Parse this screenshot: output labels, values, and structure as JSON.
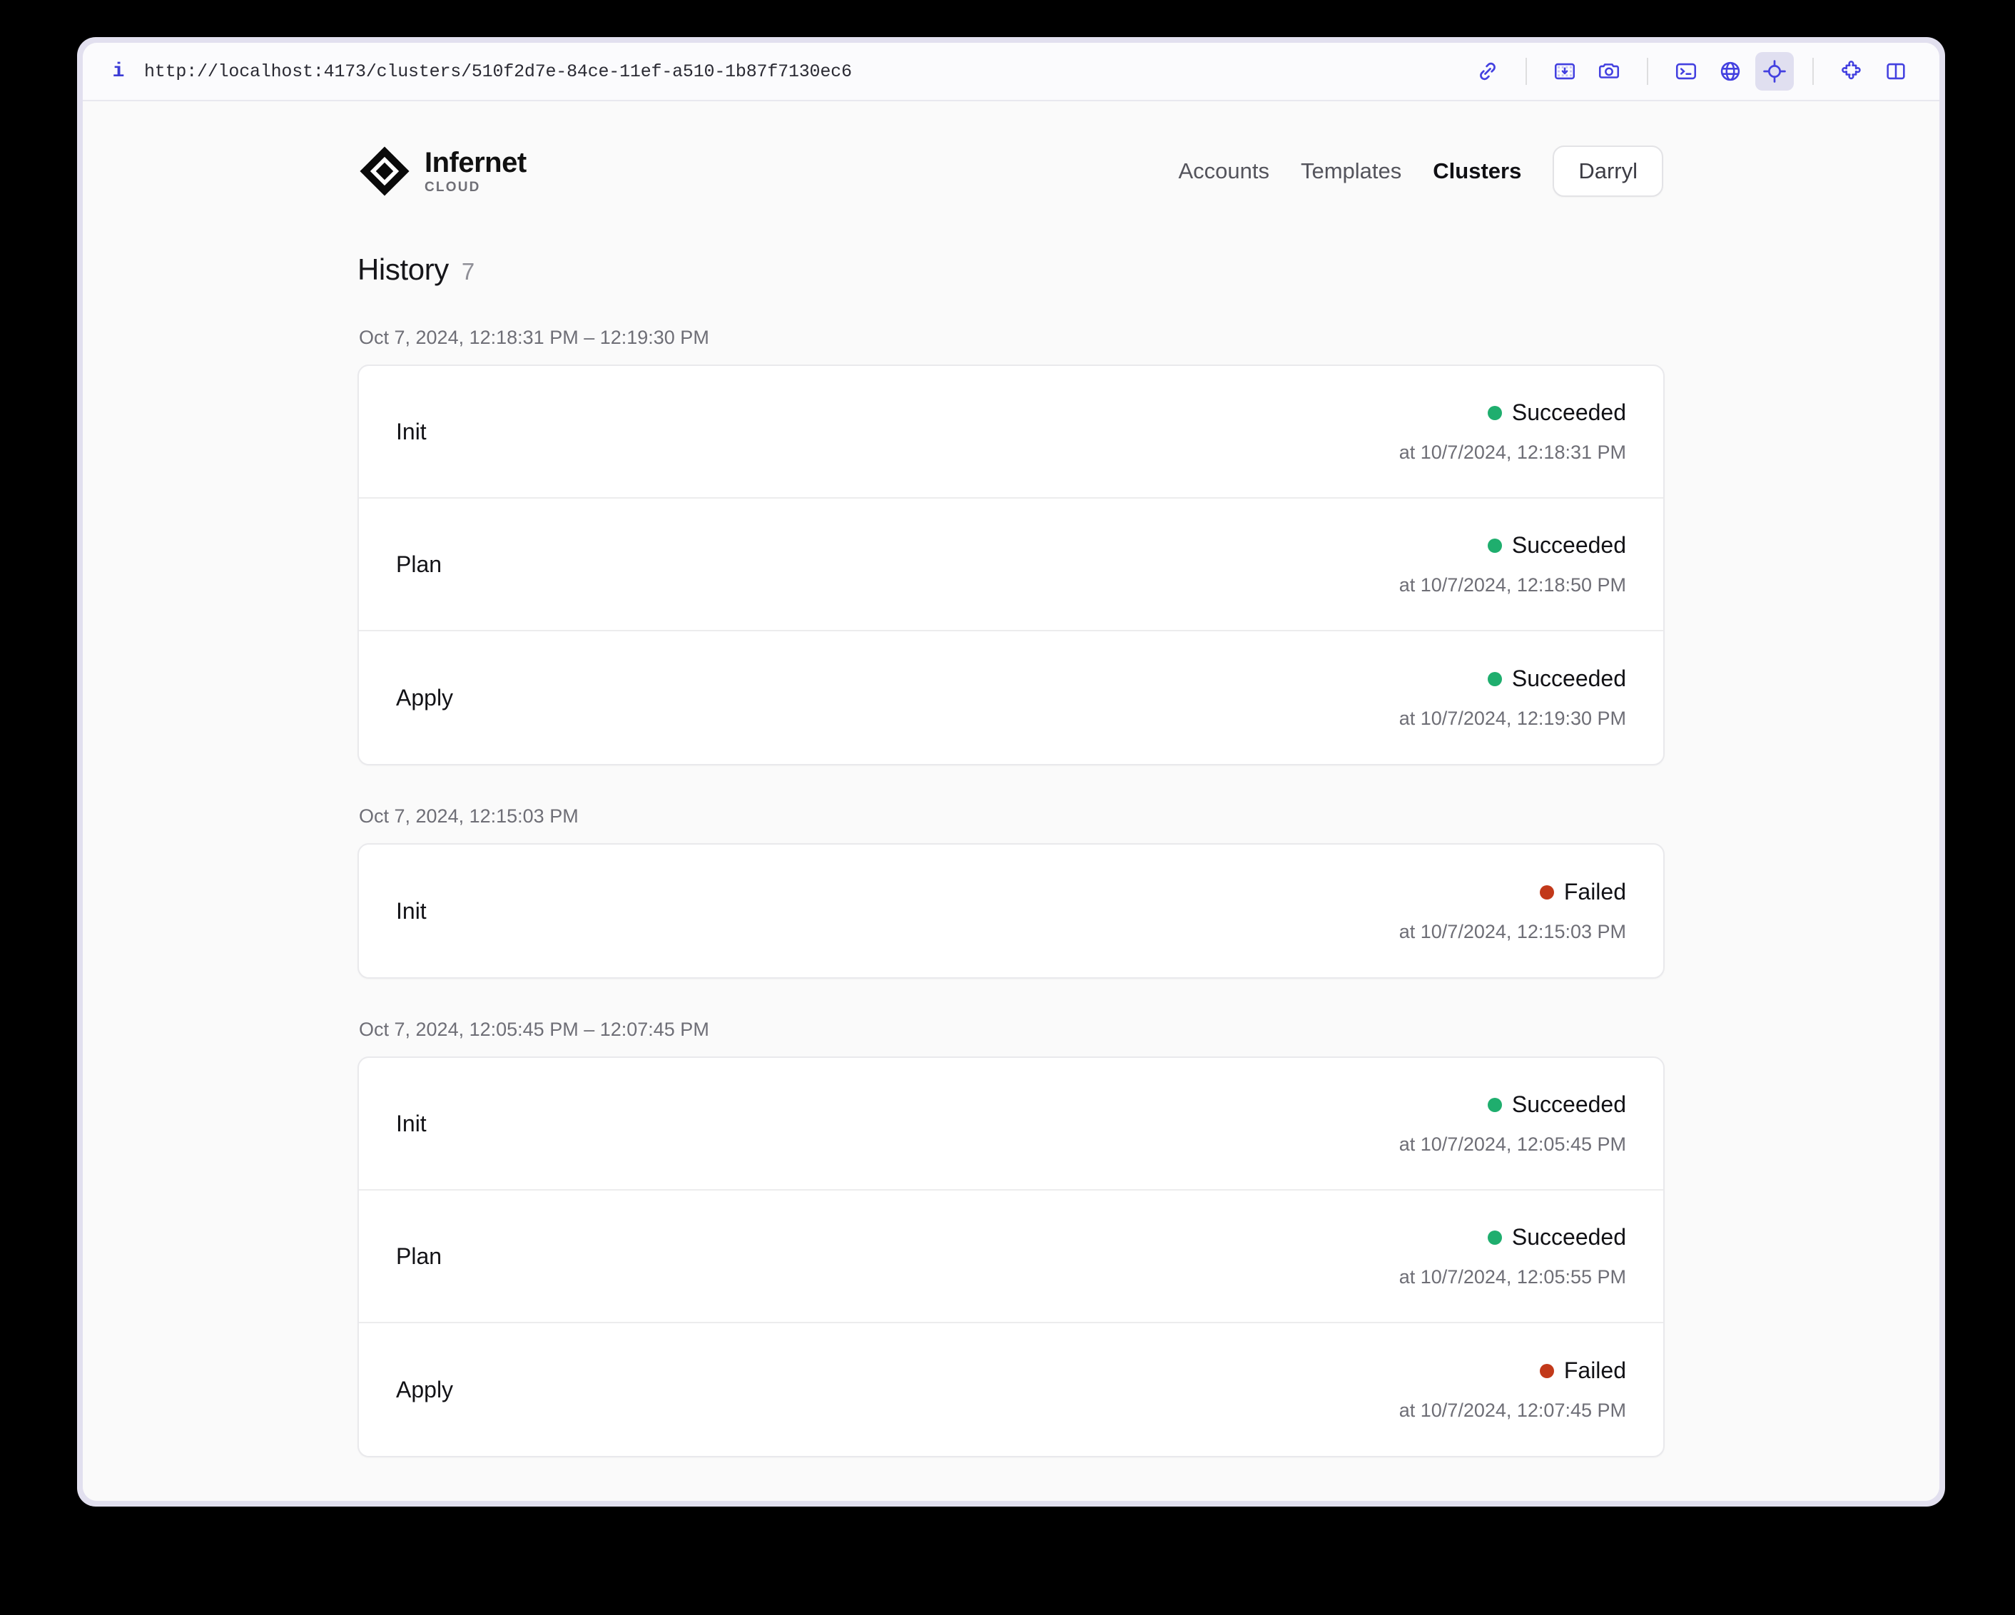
{
  "browser": {
    "info_icon": "info-icon",
    "url": "http://localhost:4173/clusters/510f2d7e-84ce-11ef-a510-1b87f7130ec6",
    "tools": [
      {
        "name": "link-icon",
        "active": false
      },
      {
        "name": "image-download-icon",
        "active": false
      },
      {
        "name": "camera-icon",
        "active": false
      },
      {
        "name": "terminal-icon",
        "active": false
      },
      {
        "name": "globe-icon",
        "active": false
      },
      {
        "name": "target-crosshair-icon",
        "active": true
      },
      {
        "name": "puzzle-icon",
        "active": false
      },
      {
        "name": "split-panel-icon",
        "active": false
      }
    ]
  },
  "app": {
    "brand": {
      "name": "Infernet",
      "sub": "CLOUD",
      "logo": "diamond-logo-icon"
    },
    "nav": [
      {
        "label": "Accounts",
        "active": false
      },
      {
        "label": "Templates",
        "active": false
      },
      {
        "label": "Clusters",
        "active": true
      }
    ],
    "user_button": "Darryl"
  },
  "history": {
    "title": "History",
    "count": "7",
    "colors": {
      "succeeded": "#1fae6e",
      "failed": "#c2391a"
    },
    "groups": [
      {
        "label": "Oct 7, 2024, 12:18:31 PM – 12:19:30 PM",
        "rows": [
          {
            "label": "Init",
            "status": "Succeeded",
            "state": "succeeded",
            "time": "at 10/7/2024, 12:18:31 PM"
          },
          {
            "label": "Plan",
            "status": "Succeeded",
            "state": "succeeded",
            "time": "at 10/7/2024, 12:18:50 PM"
          },
          {
            "label": "Apply",
            "status": "Succeeded",
            "state": "succeeded",
            "time": "at 10/7/2024, 12:19:30 PM"
          }
        ]
      },
      {
        "label": "Oct 7, 2024, 12:15:03 PM",
        "rows": [
          {
            "label": "Init",
            "status": "Failed",
            "state": "failed",
            "time": "at 10/7/2024, 12:15:03 PM"
          }
        ]
      },
      {
        "label": "Oct 7, 2024, 12:05:45 PM – 12:07:45 PM",
        "rows": [
          {
            "label": "Init",
            "status": "Succeeded",
            "state": "succeeded",
            "time": "at 10/7/2024, 12:05:45 PM"
          },
          {
            "label": "Plan",
            "status": "Succeeded",
            "state": "succeeded",
            "time": "at 10/7/2024, 12:05:55 PM"
          },
          {
            "label": "Apply",
            "status": "Failed",
            "state": "failed",
            "time": "at 10/7/2024, 12:07:45 PM"
          }
        ]
      }
    ]
  }
}
